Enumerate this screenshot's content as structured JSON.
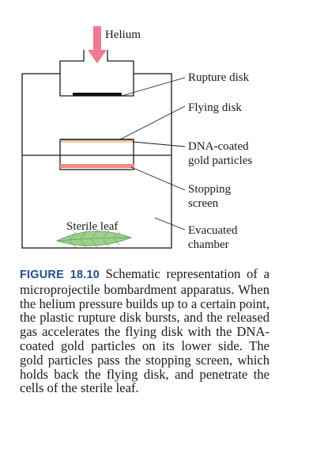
{
  "diagram": {
    "gas_label": "Helium",
    "labels": {
      "rupture_disk": "Rupture disk",
      "flying_disk": "Flying disk",
      "dna_line1": "DNA-coated",
      "dna_line2": "gold particles",
      "stopping_line1": "Stopping",
      "stopping_line2": "screen",
      "sterile_leaf": "Sterile leaf",
      "evacuated_line1": "Evacuated",
      "evacuated_line2": "chamber"
    },
    "colors": {
      "helium_arrow": "#f07a93",
      "dna_particles": "#f5c8a0",
      "stopping_screen": "#f28a80",
      "leaf_fill": "#9fd08a",
      "leaf_stroke": "#6aa86a",
      "rupture_disk": "#111111"
    }
  },
  "caption": {
    "figure_label": "FIGURE 18.10",
    "text": " Schematic representation of a microprojectile bombardment ap­paratus. When the helium pressure builds up to a certain point, the plastic rupture disk bursts, and the released gas accelerates the flying disk with the DNA-coated gold particles on its lower side. The gold particles pass the stop­ping screen, which holds back the flying disk, and penetrate the cells of the sterile leaf."
  }
}
